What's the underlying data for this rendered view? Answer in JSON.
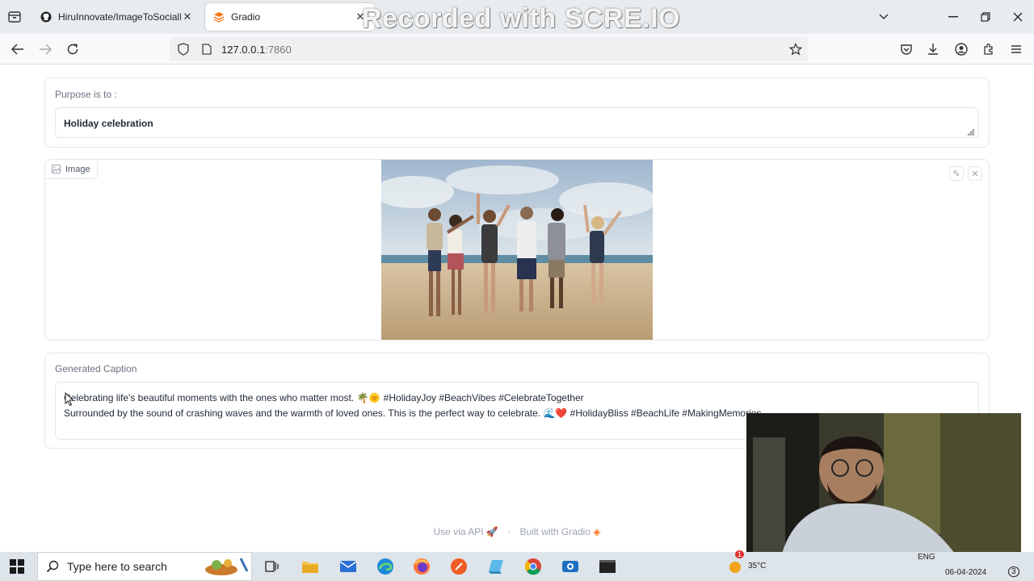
{
  "browser": {
    "tabs": [
      {
        "title": "HiruInnovate/ImageToSocialMe",
        "active": false
      },
      {
        "title": "Gradio",
        "active": true
      }
    ],
    "url_host": "127.0.0.1",
    "url_port": ":7860",
    "watermark": "Recorded with SCRE.IO"
  },
  "page": {
    "purpose": {
      "label": "Purpose is to :",
      "value": "Holiday celebration"
    },
    "image": {
      "label": "Image"
    },
    "caption": {
      "label": "Generated Caption",
      "line1": "Celebrating life's beautiful moments with the ones who matter most. 🌴🌞 #HolidayJoy #BeachVibes #CelebrateTogether",
      "line2": "Surrounded by the sound of crashing waves and the warmth of loved ones. This is the perfect way to celebrate. 🌊❤️ #HolidayBliss #BeachLife #MakingMemories"
    },
    "footer": {
      "api": "Use via API",
      "built": "Built with Gradio"
    }
  },
  "taskbar": {
    "search_placeholder": "Type here to search",
    "weather": "35°C",
    "lang": "ENG",
    "date": "06-04-2024",
    "notifications": "3",
    "weather_badge": "1"
  },
  "colors": {
    "accent_orange": "#f97316",
    "label_gray": "#6b7280",
    "border": "#e5e7eb"
  }
}
